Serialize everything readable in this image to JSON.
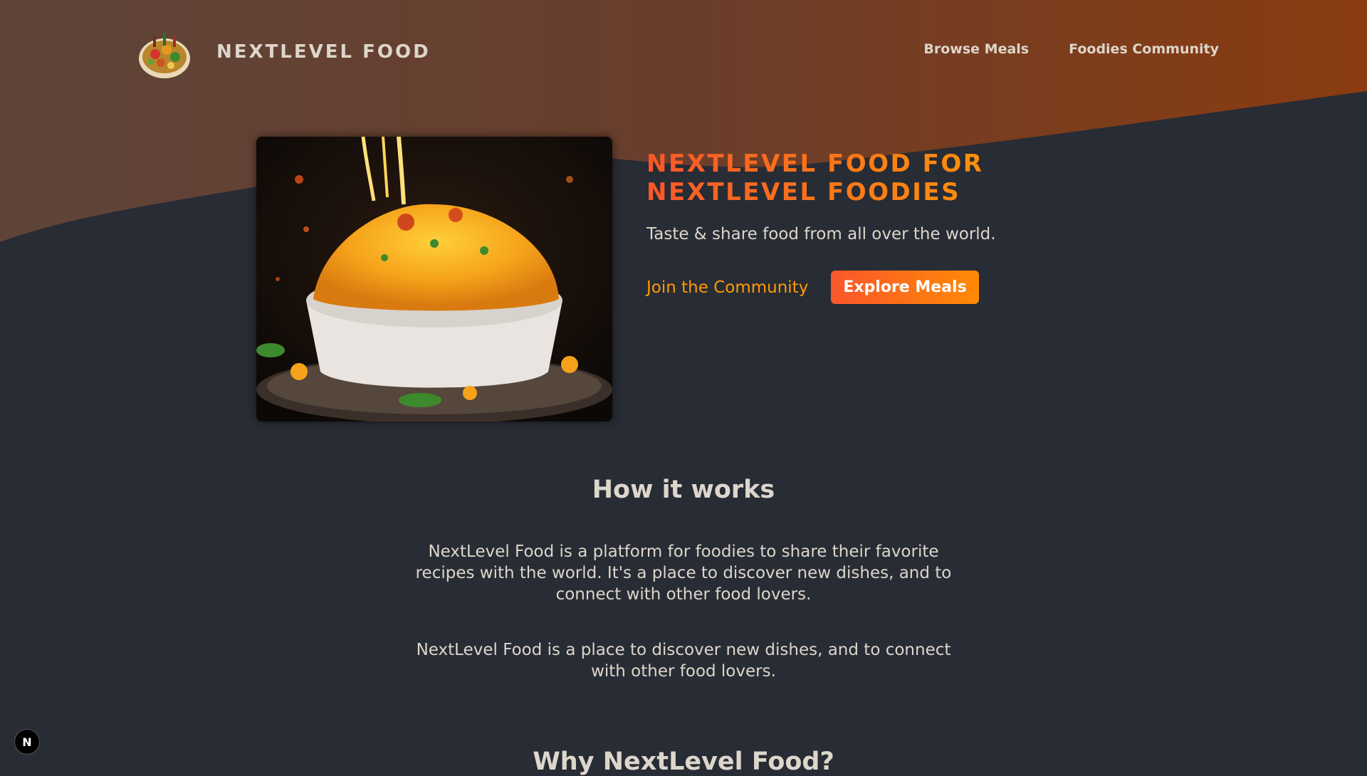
{
  "header": {
    "logo_alt": "A plate with food on it",
    "brand": "NextLevel Food",
    "nav": [
      {
        "label": "Browse Meals"
      },
      {
        "label": "Foodies Community"
      }
    ]
  },
  "hero": {
    "image_alt": "Mac and cheese",
    "title_line1": "NextLevel Food for",
    "title_line2": "NextLevel Foodies",
    "subtitle": "Taste & share food from all over the world.",
    "join_label": "Join the Community",
    "explore_label": "Explore Meals"
  },
  "how": {
    "heading": "How it works",
    "p1": "NextLevel Food is a platform for foodies to share their favorite recipes with the world. It's a place to discover new dishes, and to connect with other food lovers.",
    "p2": "NextLevel Food is a place to discover new dishes, and to connect with other food lovers."
  },
  "why": {
    "heading": "Why NextLevel Food?"
  },
  "dev_badge": {
    "letter": "N"
  },
  "colors": {
    "background": "#282c34",
    "accent_start": "#f9572a",
    "accent_end": "#ff9b05",
    "text": "#ddd6cb"
  }
}
